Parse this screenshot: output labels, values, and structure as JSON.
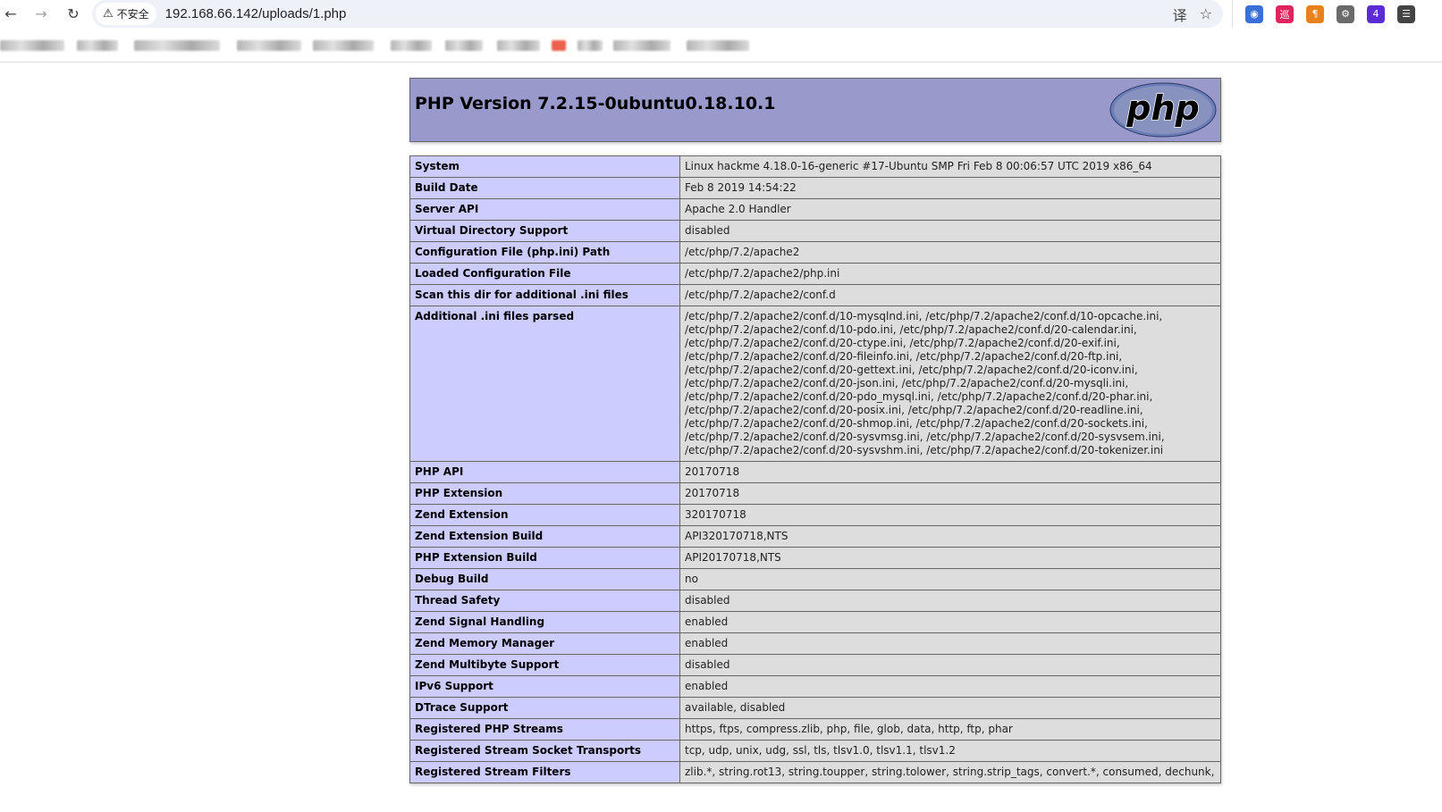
{
  "browser": {
    "back_icon": "←",
    "forward_icon": "→",
    "reload_icon": "↻",
    "security_warning_icon": "⚠",
    "security_label": "不安全",
    "url": "192.168.66.142/uploads/1.php",
    "translate_icon": "译",
    "bookmark_star_icon": "☆"
  },
  "extensions": [
    {
      "name": "globe-extension",
      "glyph": "◉",
      "color": "#3b6fd8"
    },
    {
      "name": "red-extension",
      "glyph": "巡",
      "color": "#e0245e"
    },
    {
      "name": "paragraph-extension",
      "glyph": "¶",
      "color": "#e8811a"
    },
    {
      "name": "proxy-extension",
      "glyph": "⚙",
      "color": "#6a6a6a"
    },
    {
      "name": "purple-extension",
      "glyph": "4",
      "color": "#5b2bd6"
    },
    {
      "name": "menu-extension",
      "glyph": "☰",
      "color": "#444444"
    }
  ],
  "phpinfo": {
    "title": "PHP Version 7.2.15-0ubuntu0.18.10.1",
    "logo_text": "php",
    "rows": [
      {
        "key": "System",
        "value": "Linux hackme 4.18.0-16-generic #17-Ubuntu SMP Fri Feb 8 00:06:57 UTC 2019 x86_64"
      },
      {
        "key": "Build Date",
        "value": "Feb 8 2019 14:54:22"
      },
      {
        "key": "Server API",
        "value": "Apache 2.0 Handler"
      },
      {
        "key": "Virtual Directory Support",
        "value": "disabled"
      },
      {
        "key": "Configuration File (php.ini) Path",
        "value": "/etc/php/7.2/apache2"
      },
      {
        "key": "Loaded Configuration File",
        "value": "/etc/php/7.2/apache2/php.ini"
      },
      {
        "key": "Scan this dir for additional .ini files",
        "value": "/etc/php/7.2/apache2/conf.d"
      },
      {
        "key": "Additional .ini files parsed",
        "value": "/etc/php/7.2/apache2/conf.d/10-mysqlnd.ini, /etc/php/7.2/apache2/conf.d/10-opcache.ini,\n/etc/php/7.2/apache2/conf.d/10-pdo.ini, /etc/php/7.2/apache2/conf.d/20-calendar.ini,\n/etc/php/7.2/apache2/conf.d/20-ctype.ini, /etc/php/7.2/apache2/conf.d/20-exif.ini,\n/etc/php/7.2/apache2/conf.d/20-fileinfo.ini, /etc/php/7.2/apache2/conf.d/20-ftp.ini,\n/etc/php/7.2/apache2/conf.d/20-gettext.ini, /etc/php/7.2/apache2/conf.d/20-iconv.ini,\n/etc/php/7.2/apache2/conf.d/20-json.ini, /etc/php/7.2/apache2/conf.d/20-mysqli.ini,\n/etc/php/7.2/apache2/conf.d/20-pdo_mysql.ini, /etc/php/7.2/apache2/conf.d/20-phar.ini,\n/etc/php/7.2/apache2/conf.d/20-posix.ini, /etc/php/7.2/apache2/conf.d/20-readline.ini,\n/etc/php/7.2/apache2/conf.d/20-shmop.ini, /etc/php/7.2/apache2/conf.d/20-sockets.ini,\n/etc/php/7.2/apache2/conf.d/20-sysvmsg.ini, /etc/php/7.2/apache2/conf.d/20-sysvsem.ini,\n/etc/php/7.2/apache2/conf.d/20-sysvshm.ini, /etc/php/7.2/apache2/conf.d/20-tokenizer.ini"
      },
      {
        "key": "PHP API",
        "value": "20170718"
      },
      {
        "key": "PHP Extension",
        "value": "20170718"
      },
      {
        "key": "Zend Extension",
        "value": "320170718"
      },
      {
        "key": "Zend Extension Build",
        "value": "API320170718,NTS"
      },
      {
        "key": "PHP Extension Build",
        "value": "API20170718,NTS"
      },
      {
        "key": "Debug Build",
        "value": "no"
      },
      {
        "key": "Thread Safety",
        "value": "disabled"
      },
      {
        "key": "Zend Signal Handling",
        "value": "enabled"
      },
      {
        "key": "Zend Memory Manager",
        "value": "enabled"
      },
      {
        "key": "Zend Multibyte Support",
        "value": "disabled"
      },
      {
        "key": "IPv6 Support",
        "value": "enabled"
      },
      {
        "key": "DTrace Support",
        "value": "available, disabled"
      },
      {
        "key": "Registered PHP Streams",
        "value": "https, ftps, compress.zlib, php, file, glob, data, http, ftp, phar"
      },
      {
        "key": "Registered Stream Socket Transports",
        "value": "tcp, udp, unix, udg, ssl, tls, tlsv1.0, tlsv1.1, tlsv1.2"
      },
      {
        "key": "Registered Stream Filters",
        "value": "zlib.*, string.rot13, string.toupper, string.tolower, string.strip_tags, convert.*, consumed, dechunk,"
      }
    ]
  }
}
